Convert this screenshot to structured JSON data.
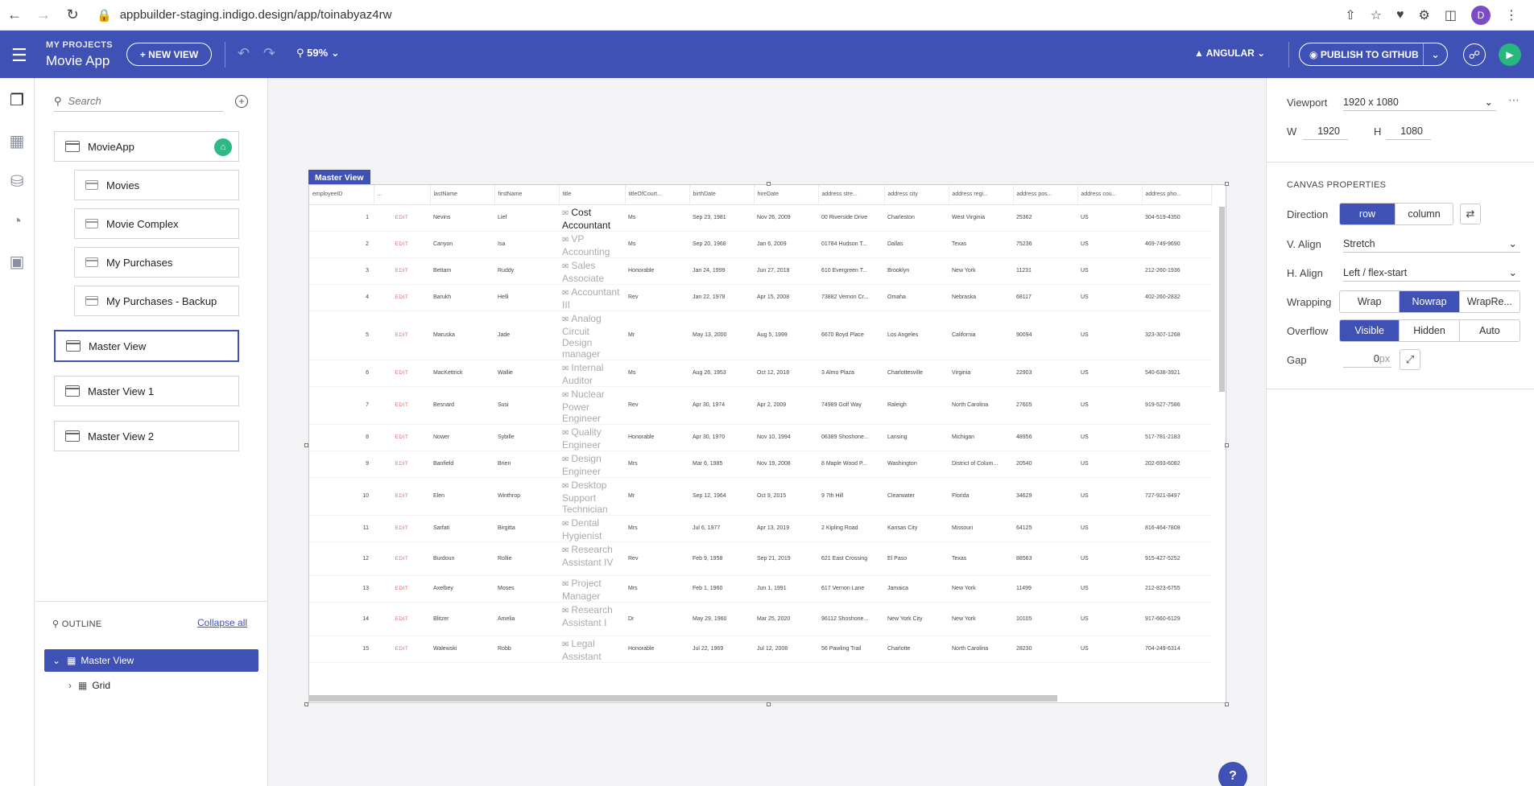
{
  "browser": {
    "url": "appbuilder-staging.indigo.design/app/toinabyaz4rw",
    "profile_initial": "D"
  },
  "header": {
    "projects_label": "MY PROJECTS",
    "project_name": "Movie App",
    "new_view_label": "+ NEW VIEW",
    "zoom": "59%",
    "framework": "ANGULAR",
    "publish_label": "PUBLISH TO GITHUB",
    "accent_color": "#3f51b5"
  },
  "sidebar": {
    "search_placeholder": "Search",
    "views": [
      {
        "label": "MovieApp",
        "home": true
      },
      {
        "label": "Movies"
      },
      {
        "label": "Movie Complex"
      },
      {
        "label": "My Purchases"
      },
      {
        "label": "My Purchases - Backup"
      },
      {
        "label": "Master View",
        "selected": true
      },
      {
        "label": "Master View 1"
      },
      {
        "label": "Master View 2"
      }
    ],
    "outline_title": "OUTLINE",
    "collapse_all": "Collapse all",
    "outline": [
      {
        "label": "Master View"
      },
      {
        "label": "Grid"
      }
    ]
  },
  "canvas": {
    "view_tag": "Master View",
    "columns": [
      "employeeID",
      "...",
      "lastName",
      "firstName",
      "title",
      "titleOfCourt...",
      "birthDate",
      "hireDate",
      "address stre...",
      "address city",
      "address regi...",
      "address pos...",
      "address cou...",
      "address pho..."
    ],
    "rows": [
      [
        "1",
        "EDIT",
        "Nevins",
        "Lief",
        "Cost Accountant",
        "Ms",
        "Sep 23, 1981",
        "Nov 26, 2009",
        "00 Riverside Drive",
        "Charleston",
        "West Virginia",
        "25362",
        "US",
        "304-519-4350"
      ],
      [
        "2",
        "EDIT",
        "Canyon",
        "Isa",
        "VP Accounting",
        "Ms",
        "Sep 20, 1968",
        "Jan 6, 2009",
        "01784 Hudson T...",
        "Dallas",
        "Texas",
        "75236",
        "US",
        "469-749-9690"
      ],
      [
        "3",
        "EDIT",
        "Bettam",
        "Ruddy",
        "Sales Associate",
        "Honorable",
        "Jan 24, 1999",
        "Jun 27, 2018",
        "610 Evergreen T...",
        "Brooklyn",
        "New York",
        "11231",
        "US",
        "212-260-1936"
      ],
      [
        "4",
        "EDIT",
        "Barukh",
        "Helli",
        "Accountant III",
        "Rev",
        "Jan 22, 1978",
        "Apr 15, 2008",
        "73882 Vernon Cr...",
        "Omaha",
        "Nebraska",
        "68117",
        "US",
        "402-260-2832"
      ],
      [
        "5",
        "EDIT",
        "Maruska",
        "Jade",
        "Analog Circuit Design manager",
        "Mr",
        "May 13, 2000",
        "Aug 5, 1999",
        "6670 Boyd Place",
        "Los Angeles",
        "California",
        "90094",
        "US",
        "323-307-1268"
      ],
      [
        "6",
        "EDIT",
        "MacKettrick",
        "Wallie",
        "Internal Auditor",
        "Ms",
        "Aug 26, 1953",
        "Oct 12, 2018",
        "3 Almo Plaza",
        "Charlottesville",
        "Virginia",
        "22903",
        "US",
        "540-638-3921"
      ],
      [
        "7",
        "EDIT",
        "Besnard",
        "Susi",
        "Nuclear Power Engineer",
        "Rev",
        "Apr 30, 1974",
        "Apr 2, 2009",
        "74989 Golf Way",
        "Raleigh",
        "North Carolina",
        "27605",
        "US",
        "919-527-7586"
      ],
      [
        "8",
        "EDIT",
        "Nower",
        "Sybille",
        "Quality Engineer",
        "Honorable",
        "Apr 30, 1970",
        "Nov 10, 1994",
        "06389 Shoshone...",
        "Lansing",
        "Michigan",
        "48956",
        "US",
        "517-781-2183"
      ],
      [
        "9",
        "EDIT",
        "Banfield",
        "Brien",
        "Design Engineer",
        "Mrs",
        "Mar 6, 1985",
        "Nov 19, 2008",
        "8 Maple Wood P...",
        "Washington",
        "District of Colum...",
        "20540",
        "US",
        "202-693-6082"
      ],
      [
        "10",
        "EDIT",
        "Elen",
        "Winthrop",
        "Desktop Support Technician",
        "Mr",
        "Sep 12, 1964",
        "Oct 9, 2015",
        "9 7th Hill",
        "Clearwater",
        "Florida",
        "34629",
        "US",
        "727-921-8497"
      ],
      [
        "11",
        "EDIT",
        "Sarfati",
        "Birgitta",
        "Dental Hygienist",
        "Mrs",
        "Jul 6, 1977",
        "Apr 13, 2019",
        "2 Kipling Road",
        "Kansas City",
        "Missouri",
        "64125",
        "US",
        "816-464-7808"
      ],
      [
        "12",
        "EDIT",
        "Burdoun",
        "Rollie",
        "Research Assistant IV",
        "Rev",
        "Feb 9, 1958",
        "Sep 21, 2019",
        "621 East Crossing",
        "El Paso",
        "Texas",
        "88563",
        "US",
        "915-427-5252"
      ],
      [
        "13",
        "EDIT",
        "Axelbey",
        "Moses",
        "Project Manager",
        "Mrs",
        "Feb 1, 1960",
        "Jun 1, 1991",
        "617 Vernon Lane",
        "Jamaica",
        "New York",
        "11499",
        "US",
        "212-823-6755"
      ],
      [
        "14",
        "EDIT",
        "Blitzer",
        "Amelia",
        "Research Assistant I",
        "Dr",
        "May 29, 1960",
        "Mar 25, 2020",
        "96112 Shoshone...",
        "New York City",
        "New York",
        "10105",
        "US",
        "917-660-6129"
      ],
      [
        "15",
        "EDIT",
        "Walewski",
        "Robb",
        "Legal Assistant",
        "Honorable",
        "Jul 22, 1969",
        "Jul 12, 2008",
        "56 Pawling Trail",
        "Charlotte",
        "North Carolina",
        "28230",
        "US",
        "704-249-6314"
      ]
    ]
  },
  "properties": {
    "viewport_label": "Viewport",
    "viewport_value": "1920 x 1080",
    "w_label": "W",
    "w_value": "1920",
    "h_label": "H",
    "h_value": "1080",
    "section": "CANVAS PROPERTIES",
    "direction_label": "Direction",
    "direction_options": [
      "row",
      "column"
    ],
    "valign_label": "V. Align",
    "valign_value": "Stretch",
    "halign_label": "H. Align",
    "halign_value": "Left / flex-start",
    "wrapping_label": "Wrapping",
    "wrapping_options": [
      "Wrap",
      "Nowrap",
      "WrapRe..."
    ],
    "overflow_label": "Overflow",
    "overflow_options": [
      "Visible",
      "Hidden",
      "Auto"
    ],
    "gap_label": "Gap",
    "gap_value": "0",
    "gap_unit": "px"
  },
  "help_label": "?"
}
